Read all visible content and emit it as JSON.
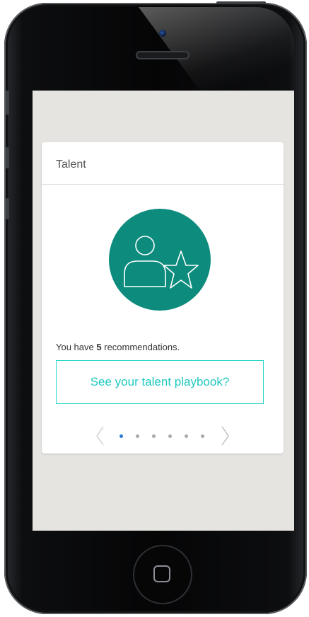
{
  "card": {
    "title": "Talent",
    "summary_prefix": "You have",
    "recommendation_count": "5",
    "summary_suffix": "recommendations.",
    "cta_label": "See your talent playbook?"
  },
  "pager": {
    "total_pages": 6,
    "active_page": 1
  },
  "colors": {
    "icon_circle": "#0d8b7d",
    "cta_accent": "#29d8cc",
    "active_dot": "#2a7ad6",
    "screen_bg": "#e6e4e1"
  },
  "icons": {
    "talent": "user-star-icon",
    "prev": "chevron-left-icon",
    "next": "chevron-right-icon",
    "home": "home-button-icon"
  }
}
